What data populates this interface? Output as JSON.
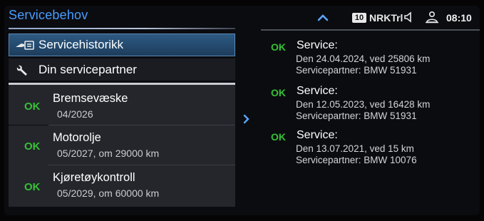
{
  "header": {
    "title": "Servicebehov",
    "channel_badge": "10",
    "station": "NRKTrl",
    "time": "08:10"
  },
  "menu": [
    {
      "label": "Servicehistorikk",
      "icon": "service-history-icon",
      "selected": true
    },
    {
      "label": "Din servicepartner",
      "icon": "wrench-icon",
      "selected": false
    }
  ],
  "service_items": [
    {
      "status": "OK",
      "name": "Bremsevæske",
      "detail": "04/2026"
    },
    {
      "status": "OK",
      "name": "Motorolje",
      "detail": "05/2027, om 29000 km"
    },
    {
      "status": "OK",
      "name": "Kjøretøykontroll",
      "detail": "05/2029, om 60000 km"
    }
  ],
  "history": [
    {
      "status": "OK",
      "title": "Service:",
      "date_line": "Den 24.04.2024, ved 25806 km",
      "partner_line": "Servicepartner: BMW 51931"
    },
    {
      "status": "OK",
      "title": "Service:",
      "date_line": "Den 12.05.2023, ved 16428 km",
      "partner_line": "Servicepartner: BMW 51931"
    },
    {
      "status": "OK",
      "title": "Service:",
      "date_line": "Den 13.07.2021, ved 15 km",
      "partner_line": "Servicepartner: BMW 10076"
    }
  ],
  "colors": {
    "accent": "#4a9cff",
    "ok_green": "#34c234",
    "selected_bg": "#2e5a83"
  }
}
